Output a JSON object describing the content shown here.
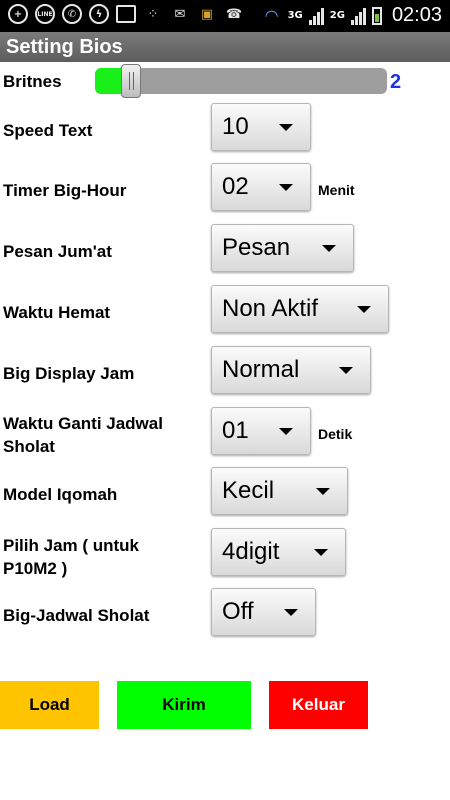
{
  "status_bar": {
    "time": "02:03",
    "network_3g": "3G",
    "network_2g": "2G",
    "left_icons": [
      "add-icon",
      "line-icon",
      "whatsapp-icon",
      "messenger-icon",
      "gallery-icon",
      "bbm-icon",
      "mail-icon",
      "gift-icon",
      "missed-call-icon"
    ],
    "right_icons": [
      "wifi-icon",
      "signal-3g-icon",
      "signal-2g-icon",
      "battery-icon"
    ]
  },
  "title": "Setting Bios",
  "brightness": {
    "label": "Britnes",
    "value": "2",
    "fill_fraction": 0.12,
    "fill_color": "#19f019",
    "value_color": "#1d32e6"
  },
  "settings": [
    {
      "label": "Speed Text",
      "value": "10"
    },
    {
      "label": "Timer Big-Hour",
      "value": "02",
      "suffix": "Menit"
    },
    {
      "label": "Pesan Jum'at",
      "value": "Pesan"
    },
    {
      "label": "Waktu Hemat",
      "value": "Non Aktif"
    },
    {
      "label": "Big Display Jam",
      "value": "Normal"
    },
    {
      "label": "Waktu Ganti Jadwal Sholat",
      "value": "01",
      "suffix": "Detik"
    },
    {
      "label": "Model Iqomah",
      "value": "Kecil"
    },
    {
      "label": "Pilih Jam ( untuk P10M2 )",
      "value": "4digit"
    },
    {
      "label": "Big-Jadwal Sholat",
      "value": "Off"
    }
  ],
  "buttons": {
    "load": {
      "label": "Load",
      "color": "#ffc400"
    },
    "kirim": {
      "label": "Kirim",
      "color": "#00ff00"
    },
    "keluar": {
      "label": "Keluar",
      "color": "#ff0000"
    }
  }
}
